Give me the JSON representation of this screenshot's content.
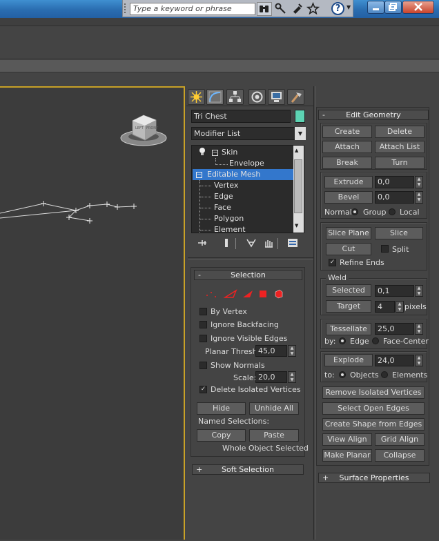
{
  "titlebar": {
    "search_placeholder": "Type a keyword or phrase",
    "help_glyph": "?"
  },
  "command_panel": {
    "tabs": [
      "create-icon",
      "modify-icon",
      "hierarchy-icon",
      "motion-icon",
      "display-icon",
      "utilities-icon"
    ],
    "object_name": "Tri Chest",
    "object_color": "#5dd3b3",
    "modifier_list_label": "Modifier List",
    "stack": {
      "skin": "Skin",
      "envelope": "Envelope",
      "editable_mesh": "Editable Mesh",
      "vertex": "Vertex",
      "edge": "Edge",
      "face": "Face",
      "polygon": "Polygon",
      "element": "Element"
    }
  },
  "selection": {
    "title": "Selection",
    "by_vertex": "By Vertex",
    "ignore_backfacing": "Ignore Backfacing",
    "ignore_visible_edges": "Ignore Visible Edges",
    "planar_thresh_label": "Planar Thresh:",
    "planar_thresh_value": "45,0",
    "show_normals": "Show Normals",
    "scale_label": "Scale:",
    "scale_value": "20,0",
    "delete_isolated": "Delete Isolated Vertices",
    "hide": "Hide",
    "unhide_all": "Unhide All",
    "named_selections": "Named Selections:",
    "copy": "Copy",
    "paste": "Paste",
    "status": "Whole Object Selected"
  },
  "soft_selection": {
    "title": "Soft Selection"
  },
  "edit_geometry": {
    "title": "Edit Geometry",
    "create": "Create",
    "delete": "Delete",
    "attach": "Attach",
    "attach_list": "Attach List",
    "break": "Break",
    "turn": "Turn",
    "extrude": "Extrude",
    "extrude_value": "0,0",
    "bevel": "Bevel",
    "bevel_value": "0,0",
    "normal_label": "Normal:",
    "group": "Group",
    "local": "Local",
    "slice_plane": "Slice Plane",
    "slice": "Slice",
    "cut": "Cut",
    "split": "Split",
    "refine_ends": "Refine Ends",
    "weld": "Weld",
    "selected": "Selected",
    "selected_value": "0,1",
    "target": "Target",
    "target_value": "4",
    "pixels": "pixels",
    "tessellate": "Tessellate",
    "tessellate_value": "25,0",
    "by_label": "by:",
    "edge": "Edge",
    "face_center": "Face-Center",
    "explode": "Explode",
    "explode_value": "24,0",
    "to_label": "to:",
    "objects": "Objects",
    "elements": "Elements",
    "remove_isolated": "Remove Isolated Vertices",
    "select_open_edges": "Select Open Edges",
    "create_shape": "Create Shape from Edges",
    "view_align": "View Align",
    "grid_align": "Grid Align",
    "make_planar": "Make Planar",
    "collapse": "Collapse"
  },
  "surface_properties": {
    "title": "Surface Properties"
  },
  "viewcube": {
    "front": "FRONT",
    "left": "LEFT"
  }
}
